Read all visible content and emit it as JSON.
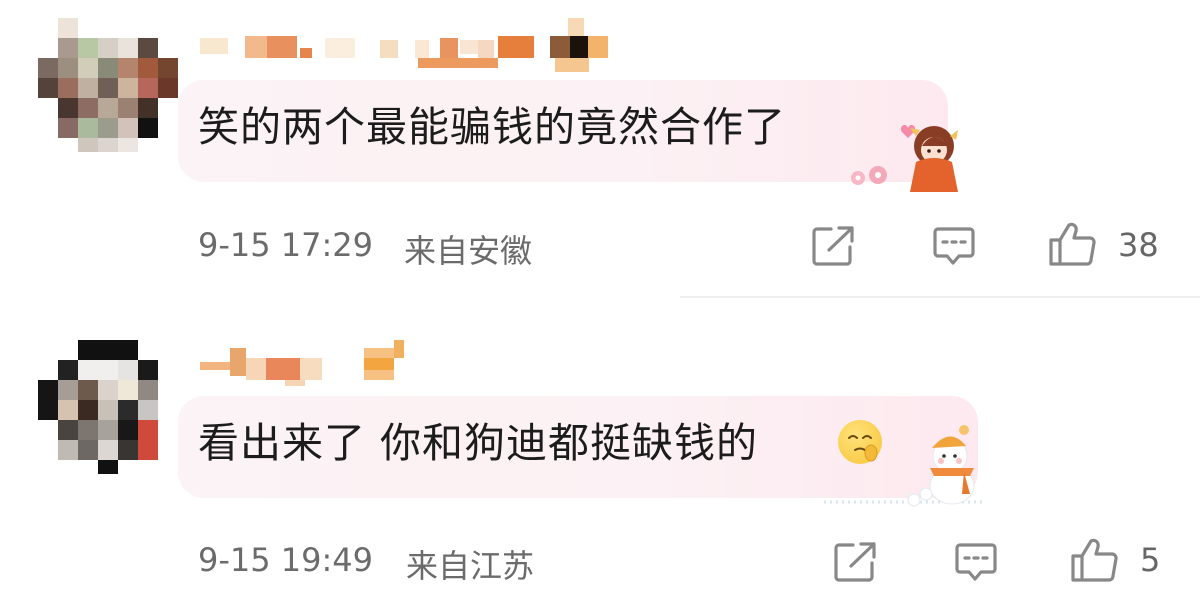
{
  "comments": [
    {
      "text": "笑的两个最能骗钱的竟然合作了",
      "time": "9-15 17:29",
      "location": "来自安徽",
      "likes": "38",
      "icons": [
        "share-icon",
        "reply-icon",
        "like-icon"
      ],
      "sticker": "girl-sticker"
    },
    {
      "text": "看出来了 你和狗迪都挺缺钱的",
      "emoji": "shush-face-emoji",
      "time": "9-15 19:49",
      "location": "来自江苏",
      "likes": "5",
      "icons": [
        "share-icon",
        "reply-icon",
        "like-icon"
      ],
      "sticker": "snowman-sticker"
    }
  ],
  "colors": {
    "bubble": "#fcf1f4",
    "meta": "#6b6b6b",
    "icon": "#888888"
  }
}
